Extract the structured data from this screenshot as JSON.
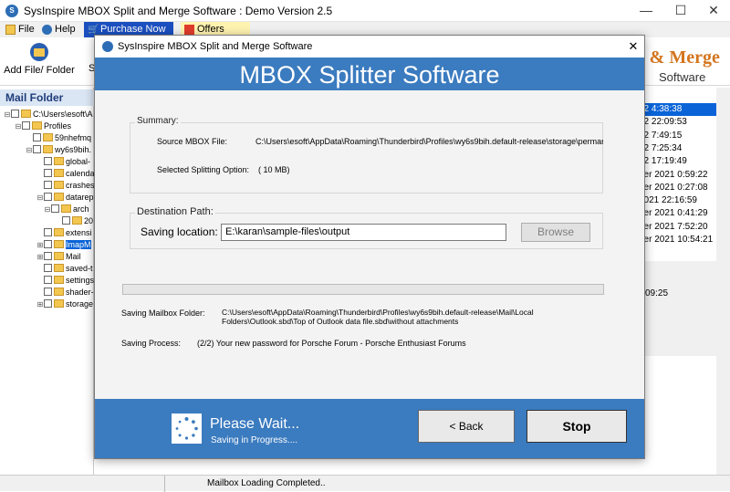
{
  "window": {
    "title": "SysInspire MBOX Split and Merge Software : Demo Version 2.5",
    "minimize": "—",
    "maximize": "☐",
    "close": "✕"
  },
  "menu": {
    "file": "File",
    "help": "Help",
    "purchase": "Purchase Now",
    "offers": "Offers"
  },
  "toolbar": {
    "add_file": "Add File/ Folder",
    "partial_next": "S",
    "brand_line1": "t & Merge",
    "brand_line2": "Software"
  },
  "left_panel": {
    "header": "Mail Folder",
    "tree": [
      {
        "label": "C:\\Users\\esoft\\A",
        "exp": "⊟"
      },
      {
        "label": "Profiles",
        "exp": "⊟"
      },
      {
        "label": "59nhefmq",
        "exp": ""
      },
      {
        "label": "wy6s9bih.",
        "exp": "⊟"
      },
      {
        "label": "global-",
        "exp": ""
      },
      {
        "label": "calenda",
        "exp": ""
      },
      {
        "label": "crashes",
        "exp": ""
      },
      {
        "label": "datarep",
        "exp": "⊟"
      },
      {
        "label": "arch",
        "exp": "⊟"
      },
      {
        "label": "20",
        "exp": ""
      },
      {
        "label": "extensi",
        "exp": ""
      },
      {
        "label": "ImapM",
        "exp": "⊞"
      },
      {
        "label": "Mail",
        "exp": "⊞"
      },
      {
        "label": "saved-t",
        "exp": ""
      },
      {
        "label": "settings",
        "exp": ""
      },
      {
        "label": "shader-",
        "exp": ""
      },
      {
        "label": "storage",
        "exp": "⊞"
      }
    ]
  },
  "right_list": {
    "rows": [
      "22 4:38:38",
      "22 22:09:53",
      "22 7:49:15",
      "22 7:25:34",
      "22 17:19:49",
      "ber 2021 0:59:22",
      "ber 2021 0:27:08",
      "2021 22:16:59",
      "ber 2021 0:41:29",
      "ber 2021 7:52:20",
      "ber 2021 10:54:21"
    ],
    "detail_time": "09:25"
  },
  "status": {
    "text": "Mailbox Loading Completed.."
  },
  "dialog": {
    "title": "SysInspire MBOX Split and Merge Software",
    "close": "✕",
    "header": "MBOX Splitter Software",
    "summary_label": "Summary:",
    "source_label": "Source MBOX File:",
    "source_value": "C:\\Users\\esoft\\AppData\\Roaming\\Thunderbird\\Profiles\\wy6s9bih.default-release\\storage\\permanent",
    "option_label": "Selected Splitting Option:",
    "option_value": "( 10 MB)",
    "dest_label": "Destination Path:",
    "saving_location_label": "Saving location:",
    "saving_location_value": "E:\\karan\\sample-files\\output",
    "browse": "Browse",
    "progress_fraction": 0,
    "saving_folder_label": "Saving Mailbox Folder:",
    "saving_folder_line1": "C:\\Users\\esoft\\AppData\\Roaming\\Thunderbird\\Profiles\\wy6s9bih.default-release\\Mail\\Local",
    "saving_folder_line2": "Folders\\Outlook.sbd\\Top of Outlook data file.sbd\\without attachments",
    "saving_process_label": "Saving Process:",
    "saving_process_value": "(2/2) Your new password for Porsche Forum - Porsche Enthusiast Forums",
    "wait_title": "Please Wait...",
    "wait_sub": "Saving in Progress....",
    "back": "< Back",
    "stop": "Stop"
  },
  "colors": {
    "accent_blue": "#3b7bbf",
    "purchase_bg": "#1b4fbf",
    "offers_bg": "#fff3b0",
    "brand_orange": "#d4751e",
    "selection_blue": "#0a64d8"
  }
}
